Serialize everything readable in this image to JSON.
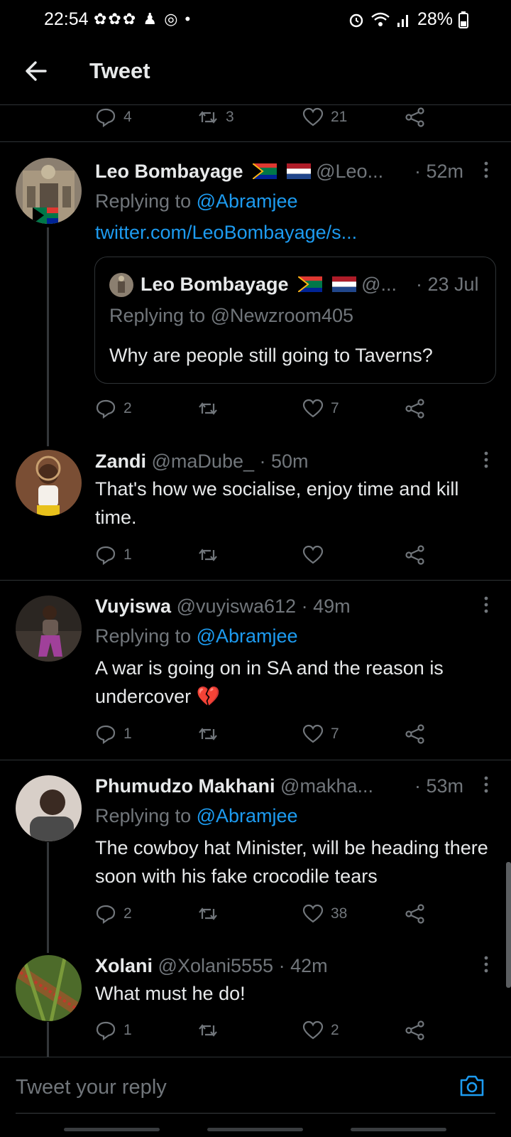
{
  "status_bar": {
    "time": "22:54",
    "battery": "28%"
  },
  "header": {
    "title": "Tweet"
  },
  "top_tweet_actions": {
    "replies": "4",
    "retweets": "3",
    "likes": "21"
  },
  "tweets": [
    {
      "name": "Leo Bombayage",
      "handle": "@Leo...",
      "time": "· 52m",
      "replying_prefix": "Replying to",
      "replying_to": "@Abramjee",
      "link": "twitter.com/LeoBombayage/s...",
      "quote": {
        "name": "Leo Bombayage",
        "handle": "@...",
        "time": "· 23 Jul",
        "replying": "Replying to @Newzroom405",
        "text": "Why are people still going to Taverns?"
      },
      "replies": "2",
      "retweets": "",
      "likes": "7"
    },
    {
      "name": "Zandi",
      "handle": "@maDube_",
      "time": "· 50m",
      "text": "That's how we socialise, enjoy time and kill time.",
      "replies": "1",
      "retweets": "",
      "likes": ""
    },
    {
      "name": "Vuyiswa",
      "handle": "@vuyiswa612",
      "time": "· 49m",
      "replying_prefix": "Replying to",
      "replying_to": "@Abramjee",
      "text": "A war is going on in SA and the reason is undercover",
      "emoji": "💔",
      "replies": "1",
      "retweets": "",
      "likes": "7"
    },
    {
      "name": "Phumudzo Makhani",
      "handle": "@makha...",
      "time": "· 53m",
      "replying_prefix": "Replying to",
      "replying_to": "@Abramjee",
      "text": "The cowboy hat Minister, will be heading there soon with his fake crocodile tears",
      "replies": "2",
      "retweets": "",
      "likes": "38"
    },
    {
      "name": "Xolani",
      "handle": "@Xolani5555",
      "time": "· 42m",
      "text": "What must he do!",
      "replies": "1",
      "retweets": "",
      "likes": "2"
    }
  ],
  "reply_bar": {
    "placeholder": "Tweet your reply"
  },
  "colors": {
    "background": "#000000",
    "accent": "#1d9bf0",
    "muted": "#71767b",
    "text": "#e7e9ea"
  }
}
